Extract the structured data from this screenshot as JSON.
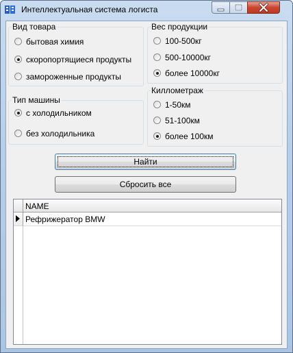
{
  "window": {
    "title": "Интеллектуальная система логиста"
  },
  "groups": {
    "product_type": {
      "legend": "Вид товара",
      "options": [
        {
          "label": "бытовая химия",
          "checked": false
        },
        {
          "label": "скоропортящиеся продукты",
          "checked": true
        },
        {
          "label": "замороженные продукты",
          "checked": false
        }
      ]
    },
    "weight": {
      "legend": "Вес продукции",
      "options": [
        {
          "label": "100-500кг",
          "checked": false
        },
        {
          "label": "500-10000кг",
          "checked": false
        },
        {
          "label": "более 10000кг",
          "checked": true
        }
      ]
    },
    "vehicle": {
      "legend": "Тип машины",
      "options": [
        {
          "label": "с холодильником",
          "checked": true
        },
        {
          "label": "без холодильника",
          "checked": false
        }
      ]
    },
    "distance": {
      "legend": "Киллометраж",
      "options": [
        {
          "label": "1-50км",
          "checked": false
        },
        {
          "label": "51-100км",
          "checked": false
        },
        {
          "label": "более 100км",
          "checked": true
        }
      ]
    }
  },
  "buttons": {
    "find": "Найти",
    "reset": "Сбросить все"
  },
  "grid": {
    "columns": [
      "NAME"
    ],
    "rows": [
      [
        "Рефрижератор BMW"
      ]
    ]
  },
  "colors": {
    "close_button": "#c9452f",
    "titlebar": "#b7cfe9",
    "client_bg": "#f0f0f0"
  }
}
